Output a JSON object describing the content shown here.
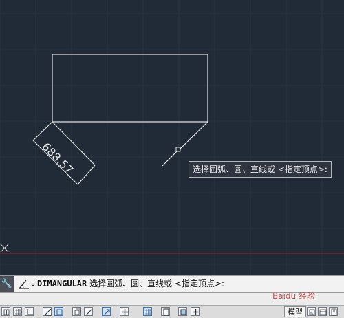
{
  "canvas": {
    "background": "#212a37",
    "line_color": "#e6e6e6",
    "ucs_axis_color": "#8c2a2a",
    "dimension_text": "688.57"
  },
  "tooltip": {
    "text": "选择圆弧、圆、直线或 <指定顶点>:"
  },
  "command_line": {
    "command": "DIMANGULAR",
    "prompt": "选择圆弧、圆、直线或 <指定顶点>:"
  },
  "status_bar": {
    "model_label": "模型",
    "buttons": [
      "snap-grid-icon",
      "grid-display-icon",
      "ortho-icon",
      "polar-tracking-icon",
      "object-snap-icon",
      "3d-object-snap-icon",
      "object-snap-tracking-icon",
      "dynamic-ucs-icon",
      "dynamic-input-icon",
      "lineweight-icon",
      "transparency-icon",
      "quick-properties-icon",
      "selection-cycling-icon"
    ]
  },
  "watermark": {
    "text": "Baidu 经验"
  }
}
